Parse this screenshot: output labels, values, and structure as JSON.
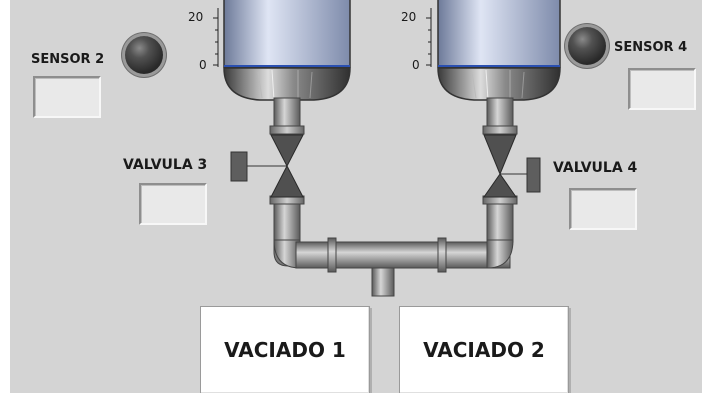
{
  "sensors": [
    {
      "id": "sensor2",
      "label": "SENSOR 2"
    },
    {
      "id": "sensor4",
      "label": "SENSOR 4"
    }
  ],
  "valves": [
    {
      "id": "valve3",
      "label": "VALVULA 3"
    },
    {
      "id": "valve4",
      "label": "VALVULA 4"
    }
  ],
  "tanks": {
    "left_scale_ticks": [
      "20",
      "0"
    ],
    "right_scale_ticks": [
      "20",
      "0"
    ]
  },
  "buttons": {
    "empty1_label": "VACIADO 1",
    "empty2_label": "VACIADO 2"
  },
  "colors": {
    "panel": "#d4d4d4",
    "indicator": "#e9e9e9",
    "tank_fill": "#9aa9cc",
    "led_off": "#3a3a3a"
  }
}
